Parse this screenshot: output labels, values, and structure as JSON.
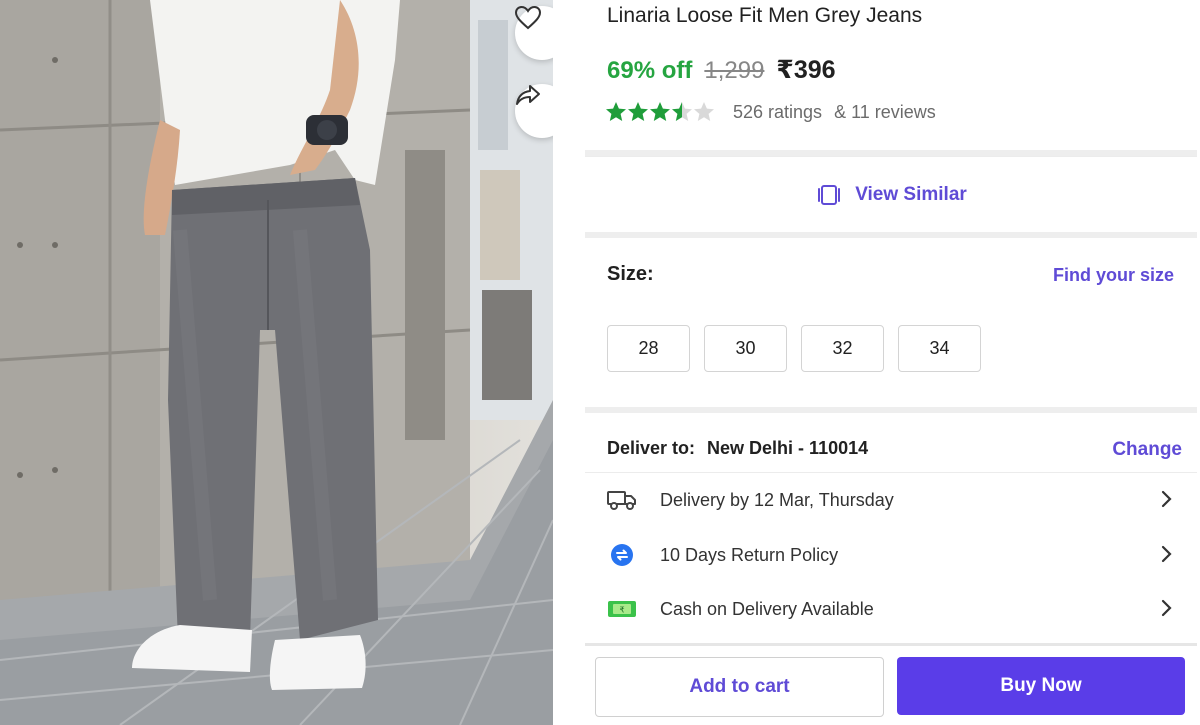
{
  "product": {
    "title": "Linaria Loose Fit Men Grey Jeans",
    "discount": "69% off",
    "mrp": "1,299",
    "price": "₹396",
    "rating_value": 3.5,
    "ratings": "526 ratings",
    "reviews": "& 11 reviews"
  },
  "actions": {
    "wishlist_icon": "heart-outline-icon",
    "share_icon": "share-arrow-icon"
  },
  "similar": {
    "label": "View Similar",
    "icon": "view-similar-icon"
  },
  "size": {
    "label": "Size:",
    "find_size": "Find your size",
    "options": [
      "28",
      "30",
      "32",
      "34"
    ]
  },
  "delivery": {
    "label": "Deliver to:",
    "location": "New Delhi - 110014",
    "change": "Change",
    "rows": [
      {
        "icon": "truck-icon",
        "text": "Delivery by 12 Mar, Thursday"
      },
      {
        "icon": "return-policy-icon",
        "text": "10 Days Return Policy"
      },
      {
        "icon": "cash-icon",
        "text": "Cash on Delivery Available"
      }
    ]
  },
  "cta": {
    "add_to_cart": "Add to cart",
    "buy_now": "Buy Now"
  },
  "colors": {
    "discount_green": "#26a541",
    "accent_purple": "#5f4bd6",
    "buy_button": "#5a3de8",
    "star_green": "#1f9d3a"
  }
}
